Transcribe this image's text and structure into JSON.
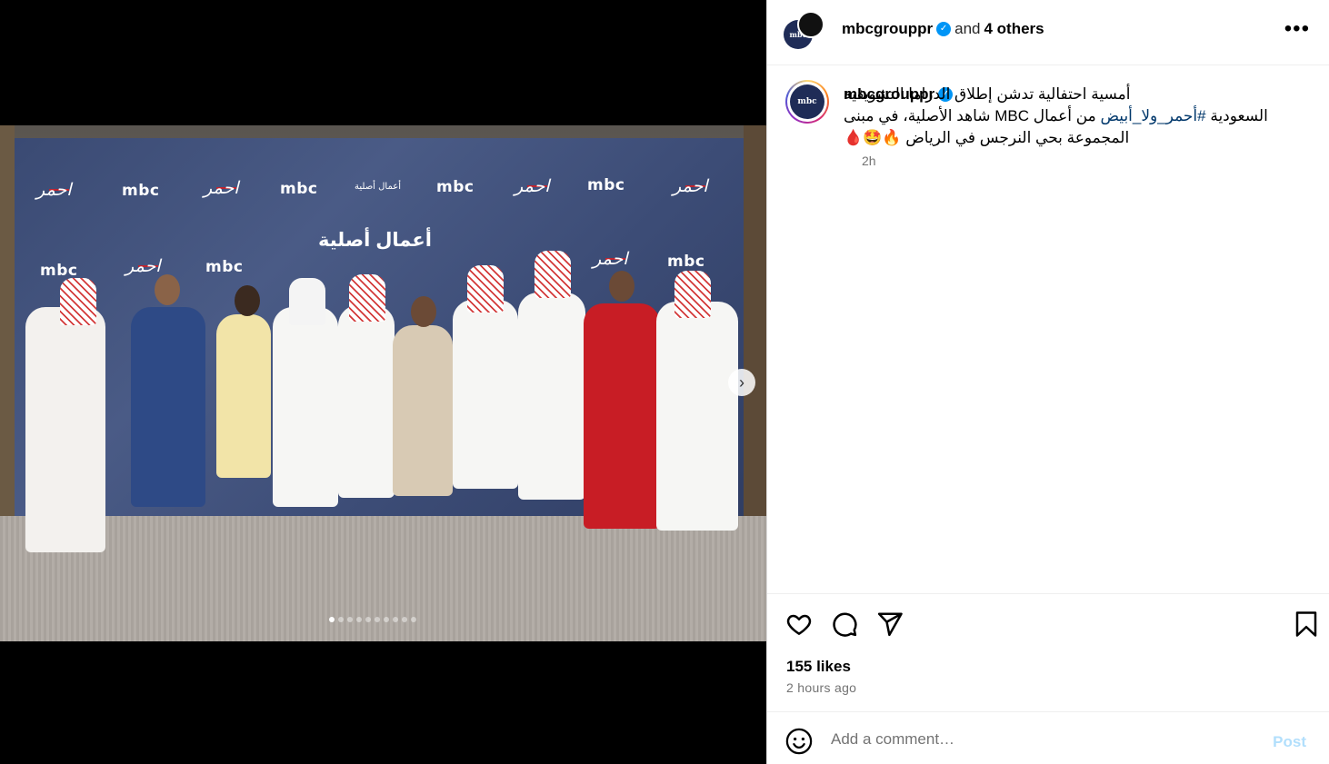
{
  "post": {
    "header": {
      "username": "mbcgrouppr",
      "and_text": "and",
      "others": "4 others",
      "more_icon": "more-horizontal-icon"
    },
    "avatar_label": "mbc",
    "caption": {
      "username": "mbcgrouppr",
      "line1": "أمسية احتفالية تدشن إطلاق الدراما التشويقية",
      "line2_pre": "السعودية ",
      "hashtag": "#أحمر_ولا_أبيض",
      "line2_post": " من أعمال MBC شاهد الأصلية، في مبنى",
      "line3": "المجموعة بحي النرجس في الرياض 🔥🤩🩸",
      "time": "2h"
    },
    "likes": "155 likes",
    "posted": "2 hours ago",
    "comment": {
      "placeholder": "Add a comment…",
      "post_label": "Post"
    }
  },
  "media": {
    "logos": [
      "mbc",
      "أعمال أصلية"
    ],
    "hero_text": "أعمال أصلية",
    "carousel_count": 10,
    "carousel_active": 1
  },
  "colors": {
    "verified": "#0095f6",
    "hashtag": "#00376b",
    "post_disabled": "#b2dffc",
    "muted": "#737373"
  }
}
